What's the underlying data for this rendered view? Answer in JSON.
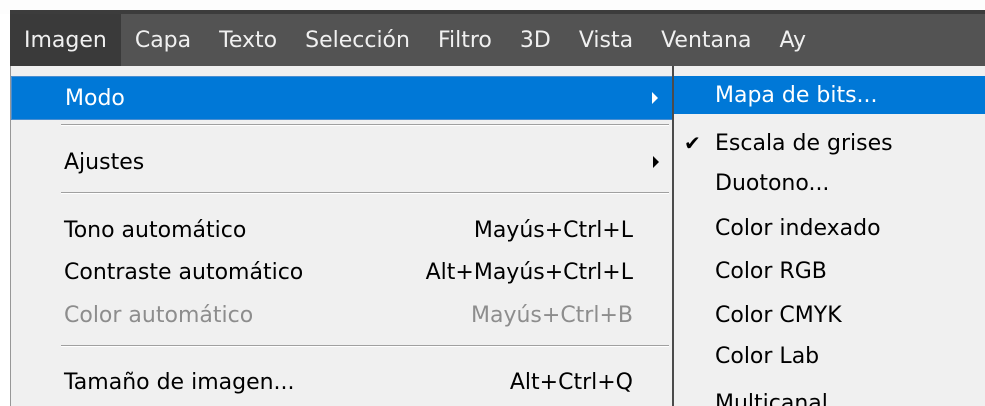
{
  "menubar": {
    "items": [
      {
        "label": "Imagen",
        "active": true
      },
      {
        "label": "Capa"
      },
      {
        "label": "Texto"
      },
      {
        "label": "Selección"
      },
      {
        "label": "Filtro"
      },
      {
        "label": "3D"
      },
      {
        "label": "Vista"
      },
      {
        "label": "Ventana"
      },
      {
        "label": "Ay"
      }
    ]
  },
  "image_menu": {
    "modo": "Modo",
    "ajustes": "Ajustes",
    "tono": {
      "label": "Tono automático",
      "shortcut": "Mayús+Ctrl+L"
    },
    "contraste": {
      "label": "Contraste automático",
      "shortcut": "Alt+Mayús+Ctrl+L"
    },
    "color": {
      "label": "Color automático",
      "shortcut": "Mayús+Ctrl+B"
    },
    "tamano": {
      "label": "Tamaño de imagen...",
      "shortcut": "Alt+Ctrl+Q"
    }
  },
  "mode_submenu": {
    "items": [
      {
        "label": "Mapa de bits...",
        "highlighted": true
      },
      {
        "label": "Escala de grises",
        "checked": true
      },
      {
        "label": "Duotono..."
      },
      {
        "label": "Color indexado"
      },
      {
        "label": "Color RGB"
      },
      {
        "label": "Color CMYK"
      },
      {
        "label": "Color Lab"
      },
      {
        "label": "Multicanal"
      }
    ],
    "check_glyph": "✔"
  },
  "colors": {
    "menubar_bg": "#535353",
    "menubar_active": "#3a3a3a",
    "menu_bg": "#f0f0f0",
    "highlight": "#0078d7",
    "disabled_text": "#8d8d8d"
  }
}
